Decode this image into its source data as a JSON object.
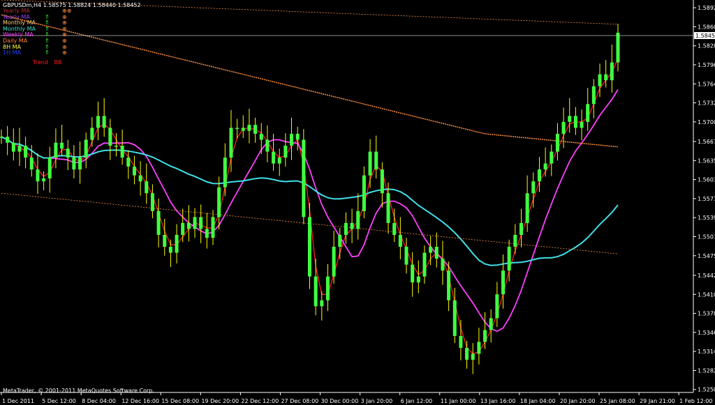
{
  "header": {
    "symbol": "GBPUSDm,H4",
    "open": "1.58575",
    "high": "1.58824",
    "low": "1.58440",
    "close": "1.58452"
  },
  "legend": [
    {
      "label": "Yearly MA",
      "color": "#b03030",
      "arrow": "",
      "circle": "⊕⊕"
    },
    {
      "label": "Yearly MA",
      "color": "#a040ff",
      "arrow": "⇑",
      "circle": "⊕"
    },
    {
      "label": "Monthly MA",
      "color": "#ffd080",
      "arrow": "⇑",
      "circle": "⊕"
    },
    {
      "label": "Monthly MA",
      "color": "#40e0d0",
      "arrow": "⇑",
      "circle": "⊕"
    },
    {
      "label": "Weekly MA",
      "color": "#ff40ff",
      "arrow": "⇑",
      "circle": "⊕"
    },
    {
      "label": "Daily MA",
      "color": "#ff8040",
      "arrow": "⇑",
      "circle": "⊕"
    },
    {
      "label": "8H MA",
      "color": "#ffff40",
      "arrow": "⇑",
      "circle": "⊕"
    },
    {
      "label": "1H MA",
      "color": "#2040ff",
      "arrow": "⇑",
      "circle": "⊕"
    }
  ],
  "trend_labels": [
    "Trend",
    "BB"
  ],
  "copyright": "MetaTrader, © 2001-2011 MetaQuotes Software Corp.",
  "current_price": "1.58452",
  "colors": {
    "background": "#000000",
    "candles": "#40ff40",
    "wicks": "#ffff00",
    "ma_red": "#ff2020",
    "ma_magenta": "#ff40ff",
    "ma_cyan": "#40e0e8",
    "ma_orange": "#ff9040",
    "axis": "#ffffff"
  },
  "chart_data": {
    "type": "line",
    "price_ticks": [
      "1.58920",
      "1.58600",
      "1.58280",
      "1.57960",
      "1.57640",
      "1.57320",
      "1.57000",
      "1.56670",
      "1.56350",
      "1.56030",
      "1.55710",
      "1.55390",
      "1.55070",
      "1.54750",
      "1.54420",
      "1.54100",
      "1.53780",
      "1.53460",
      "1.53140",
      "1.52820",
      "1.52500"
    ],
    "time_ticks": [
      "1 Dec 2011",
      "5 Dec 12:00",
      "8 Dec 04:00",
      "12 Dec 16:00",
      "15 Dec 08:00",
      "19 Dec 20:00",
      "22 Dec 12:00",
      "27 Dec 08:00",
      "30 Dec 00:00",
      "3 Jan 20:00",
      "6 Jan 12:00",
      "11 Jan 00:00",
      "13 Jan 16:00",
      "18 Jan 04:00",
      "20 Jan 20:00",
      "25 Jan 08:00",
      "29 Jan 21:00",
      "1 Feb 12:00"
    ],
    "ylim": [
      1.5245,
      1.5905
    ],
    "series": [
      {
        "color": "#40ff40",
        "values": [
          1.5675,
          1.5665,
          1.565,
          1.566,
          1.564,
          1.562,
          1.56,
          1.5605,
          1.564,
          1.5665,
          1.5655,
          1.564,
          1.562,
          1.564,
          1.567,
          1.569,
          1.571,
          1.569,
          1.566,
          1.566,
          1.564,
          1.5625,
          1.561,
          1.56,
          1.558,
          1.555,
          1.551,
          1.549,
          1.548,
          1.551,
          1.553,
          1.552,
          1.554,
          1.552,
          1.5505,
          1.554,
          1.559,
          1.564,
          1.569,
          1.569,
          1.5685,
          1.5695,
          1.568,
          1.567,
          1.565,
          1.563,
          1.564,
          1.566,
          1.568,
          1.567,
          1.554,
          1.544,
          1.539,
          1.54,
          1.544,
          1.549,
          1.551,
          1.553,
          1.552,
          1.555,
          1.561,
          1.565,
          1.562,
          1.558,
          1.553,
          1.551,
          1.549,
          1.546,
          1.543,
          1.544,
          1.548,
          1.549,
          1.547,
          1.545,
          1.54,
          1.534,
          1.532,
          1.53,
          1.531,
          1.533,
          1.535,
          1.537,
          1.541,
          1.545,
          1.549,
          1.551,
          1.553,
          1.558,
          1.56,
          1.562,
          1.563,
          1.565,
          1.568,
          1.57,
          1.571,
          1.569,
          1.57,
          1.573,
          1.576,
          1.578,
          1.577,
          1.58,
          1.585
        ]
      }
    ],
    "title": "",
    "xlabel": "",
    "ylabel": ""
  }
}
